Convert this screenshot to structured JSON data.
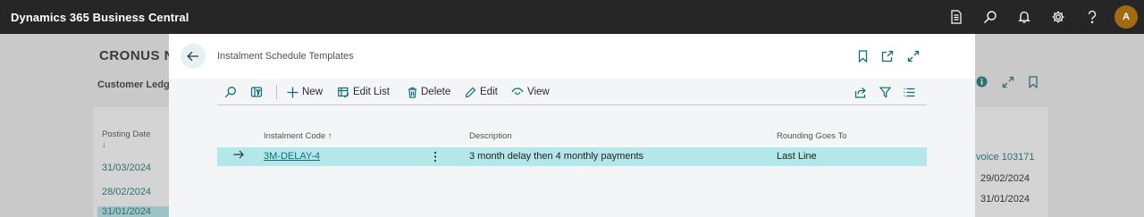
{
  "app": {
    "title": "Dynamics 365 Business Central",
    "avatar_initial": "A",
    "icons": [
      "document-icon",
      "search-icon",
      "bell-icon",
      "gear-icon",
      "help-icon"
    ]
  },
  "background_page": {
    "company": "CRONUS N",
    "subtitle": "Customer Ledge",
    "posting_date_header": "Posting Date",
    "sort_arrow": "↓",
    "left_dates": [
      "31/03/2024",
      "28/02/2024",
      "31/01/2024"
    ],
    "right_values": [
      "voice 103171",
      "29/02/2024",
      "31/01/2024"
    ]
  },
  "dialog": {
    "title": "Instalment Schedule Templates",
    "toolbar": {
      "new_label": "New",
      "edit_list_label": "Edit List",
      "delete_label": "Delete",
      "edit_label": "Edit",
      "view_label": "View"
    },
    "columns": {
      "code": "Instalment Code ↑",
      "description": "Description",
      "rounding": "Rounding Goes To"
    },
    "rows": [
      {
        "code": "3M-DELAY-4",
        "description": "3 month delay then 4 monthly payments",
        "rounding": "Last Line",
        "selected": true
      }
    ]
  },
  "colors": {
    "appbar": "#262626",
    "accent": "#106d73",
    "selected_row": "#b4e7ea",
    "avatar": "#a36a14"
  }
}
